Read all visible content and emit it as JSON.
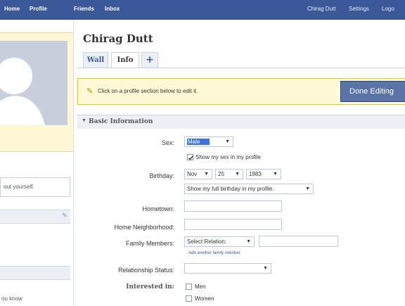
{
  "nav": {
    "home": "Home",
    "profile": "Profile",
    "friends": "Friends",
    "inbox": "Inbox",
    "user": "Chirag Dutt",
    "settings": "Settings",
    "logout": "Logo"
  },
  "sidebar": {
    "about_yourself": "out yourself.",
    "people_know": "ou know"
  },
  "profile": {
    "name": "Chirag Dutt",
    "tabs": [
      "Wall",
      "Info",
      "+"
    ]
  },
  "notice": {
    "text": "Click on a profile section below to edit it.",
    "done_label": "Done Editing"
  },
  "section": {
    "title": "Basic Information"
  },
  "form": {
    "sex_label": "Sex:",
    "sex_value": "Male",
    "show_sex": "Show my sex in my profile",
    "birthday_label": "Birthday:",
    "birthday_month": "Nov",
    "birthday_day": "25",
    "birthday_year": "1983",
    "birthday_visibility": "Show my full birthday in my profile.",
    "hometown_label": "Hometown:",
    "neighborhood_label": "Home Neighborhood:",
    "family_label": "Family Members:",
    "family_select": "Select Relation:",
    "add_family": "Add another family member",
    "relationship_label": "Relationship Status:",
    "interested_label": "Interested in:",
    "men": "Men",
    "women": "Women"
  }
}
